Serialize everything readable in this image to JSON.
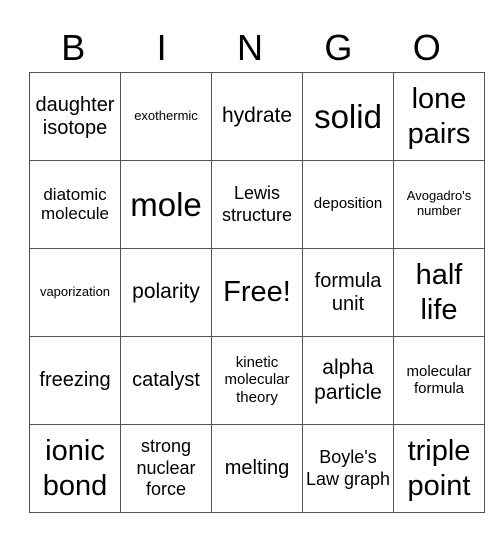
{
  "header": {
    "letters": [
      "B",
      "I",
      "N",
      "G",
      "O"
    ]
  },
  "grid": {
    "rows": [
      [
        "daughter isotope",
        "exothermic",
        "hydrate",
        "solid",
        "lone pairs"
      ],
      [
        "diatomic molecule",
        "mole",
        "Lewis structure",
        "deposition",
        "Avogadro's number"
      ],
      [
        "vaporization",
        "polarity",
        "Free!",
        "formula unit",
        "half life"
      ],
      [
        "freezing",
        "catalyst",
        "kinetic molecular theory",
        "alpha particle",
        "molecular formula"
      ],
      [
        "ionic bond",
        "strong nuclear force",
        "melting",
        "Boyle's Law graph",
        "triple point"
      ]
    ]
  },
  "colors": {
    "grid_line": "#555555",
    "text": "#000000",
    "background": "#ffffff"
  }
}
